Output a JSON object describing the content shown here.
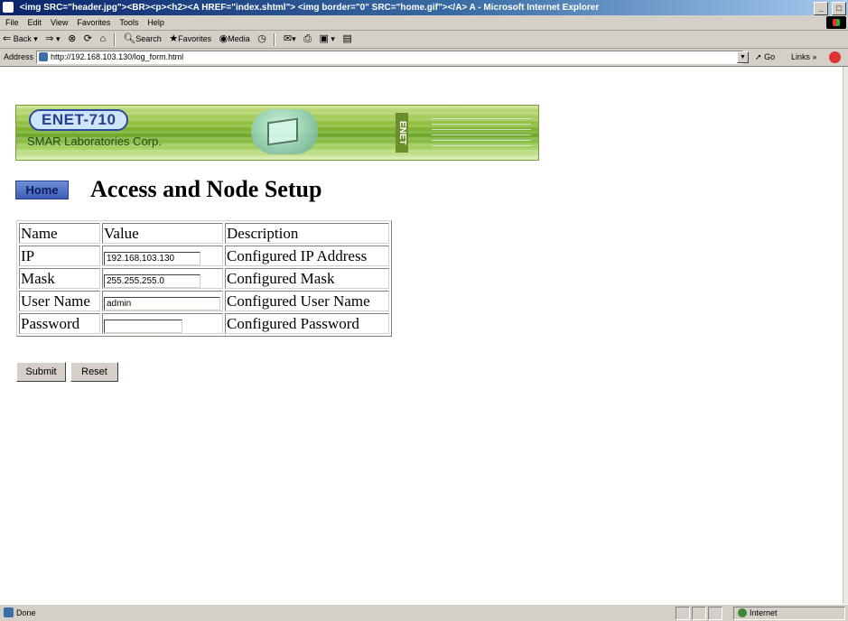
{
  "window": {
    "title": "<img SRC=\"header.jpg\"><BR><p><h2><A HREF=\"index.shtml\"> <img border=\"0\" SRC=\"home.gif\"></A>  A - Microsoft Internet Explorer",
    "minimize": "_",
    "restore": "□"
  },
  "menu": [
    "File",
    "Edit",
    "View",
    "Favorites",
    "Tools",
    "Help"
  ],
  "toolbar": {
    "back": "Back",
    "search": "Search",
    "favorites": "Favorites",
    "media": "Media"
  },
  "address": {
    "label": "Address",
    "url": "http://192.168.103.130/log_form.html",
    "go": "Go",
    "links": "Links"
  },
  "banner": {
    "product": "ENET-710",
    "company": "SMAR Laboratories Corp.",
    "vertical_text": "ENET"
  },
  "page": {
    "home_link": "Home",
    "title": "Access and Node Setup"
  },
  "table": {
    "headers": [
      "Name",
      "Value",
      "Description"
    ],
    "rows": [
      {
        "name": "IP",
        "value": "192.168.103.130",
        "description": "Configured IP Address"
      },
      {
        "name": "Mask",
        "value": "255.255.255.0",
        "description": "Configured Mask"
      },
      {
        "name": "User Name",
        "value": "admin",
        "description": "Configured User Name"
      },
      {
        "name": "Password",
        "value": "",
        "description": "Configured Password"
      }
    ]
  },
  "buttons": {
    "submit": "Submit",
    "reset": "Reset"
  },
  "status": {
    "text": "Done",
    "zone": "Internet"
  },
  "colors": {
    "titlebar": "#0a246a",
    "chrome": "#d4d0c8",
    "banner_green": "#8fbd3a",
    "home_blue": "#3e5cb8"
  }
}
